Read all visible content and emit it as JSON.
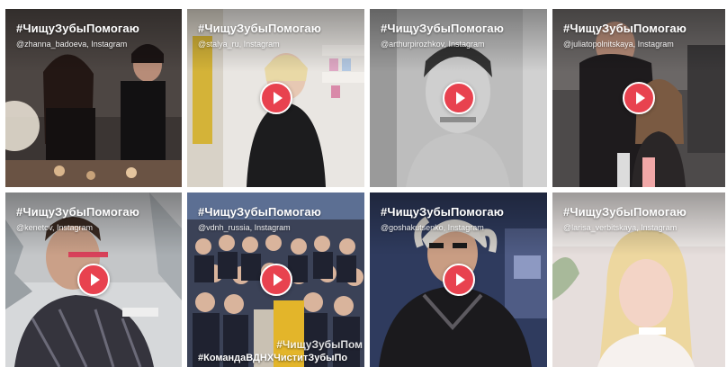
{
  "tiles": [
    {
      "hashtag": "#ЧищуЗубыПомогаю",
      "credit": "@zhanna_badoeva, Instagram"
    },
    {
      "hashtag": "#ЧищуЗубыПомогаю",
      "credit": "@stalya_ru, Instagram"
    },
    {
      "hashtag": "#ЧищуЗубыПомогаю",
      "credit": "@arthurpirozhkov, Instagram"
    },
    {
      "hashtag": "#ЧищуЗубыПомогаю",
      "credit": "@juliatopolnitskaya, Instagram"
    },
    {
      "hashtag": "#ЧищуЗубыПомогаю",
      "credit": "@kenetov, Instagram"
    },
    {
      "hashtag": "#ЧищуЗубыПомогаю",
      "credit": "@vdnh_russia, Instagram",
      "overlay_top": "#ЧищуЗубыПом",
      "overlay_bottom": "#КомандаВДНХЧиститЗубыПо"
    },
    {
      "hashtag": "#ЧищуЗубыПомогаю",
      "credit": "@goshakutsenko, Instagram"
    },
    {
      "hashtag": "#ЧищуЗубыПомогаю",
      "credit": "@larisa_verbitskaya, Instagram"
    }
  ],
  "colors": {
    "play_button": "#e8424f",
    "text": "#ffffff"
  }
}
